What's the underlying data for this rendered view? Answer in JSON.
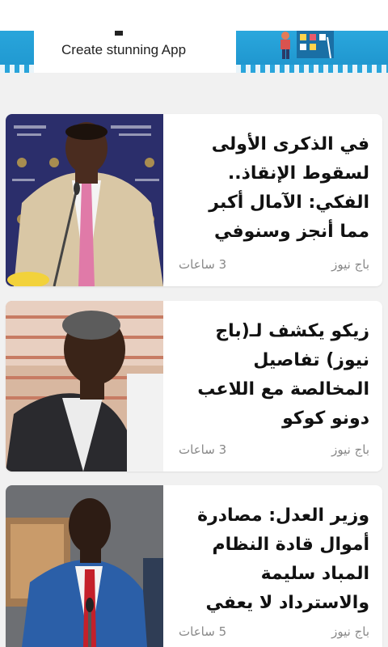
{
  "banner": {
    "cta_text": "Create stunning App",
    "accent_color": "#29a5db"
  },
  "articles": [
    {
      "title": "في الذكرى الأولى لسقوط الإنقاذ.. الفكي: الآمال أكبر مما أنجز وسنوفي",
      "source": "باج نيوز",
      "time": "3 ساعات",
      "thumb": "man-speaking-at-microphone"
    },
    {
      "title": "زيكو يكشف لـ(باج نيوز) تفاصيل المخالصة مع اللاعب دونو كوكو",
      "source": "باج نيوز",
      "time": "3 ساعات",
      "thumb": "man-portrait-outdoors"
    },
    {
      "title": "وزير العدل: مصادرة أموال قادة النظام المباد سليمة والاسترداد لا يعفي",
      "source": "باج نيوز",
      "time": "5 ساعات",
      "thumb": "man-in-blue-suit-at-microphone"
    }
  ]
}
